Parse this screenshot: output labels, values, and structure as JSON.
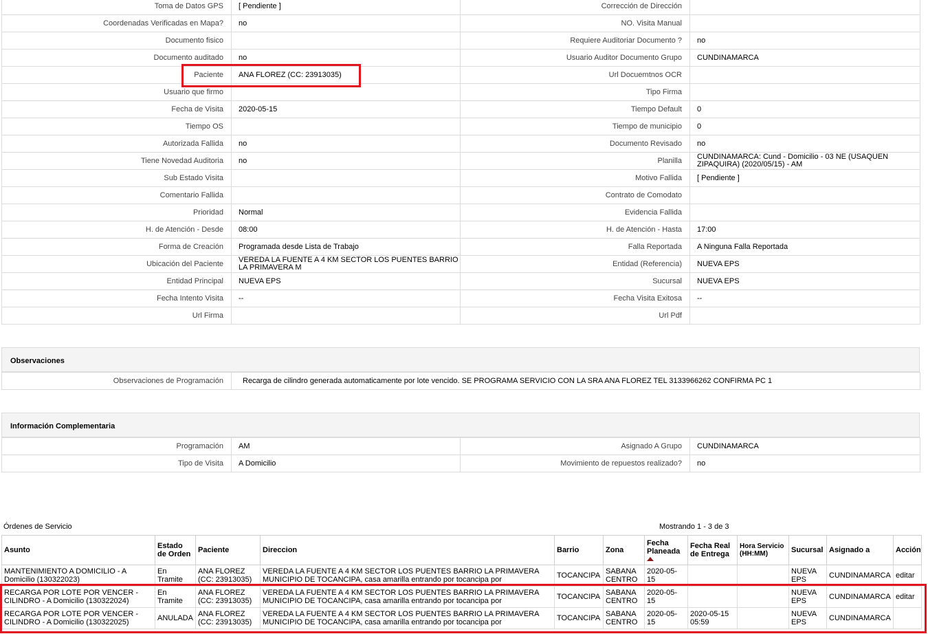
{
  "detail_rows": [
    {
      "l1": "Toma de Datos GPS",
      "v1": "[ Pendiente ]",
      "l2": "Corrección de Dirección",
      "v2": ""
    },
    {
      "l1": "Coordenadas Verificadas en Mapa?",
      "v1": "no",
      "l2": "NO. Visita Manual",
      "v2": ""
    },
    {
      "l1": "Documento fisico",
      "v1": "",
      "l2": "Requiere Auditoriar Documento ?",
      "v2": "no"
    },
    {
      "l1": "Documento auditado",
      "v1": "no",
      "l2": "Usuario Auditor Documento Grupo",
      "v2": "CUNDINAMARCA"
    },
    {
      "l1": "Paciente",
      "v1": "ANA FLOREZ (CC: 23913035)",
      "l2": "Url Docuemtnos OCR",
      "v2": ""
    },
    {
      "l1": "Usuario que firmo",
      "v1": "",
      "l2": "Tipo Firma",
      "v2": ""
    },
    {
      "l1": "Fecha de Visita",
      "v1": "2020-05-15",
      "l2": "Tiempo Default",
      "v2": "0"
    },
    {
      "l1": "Tiempo OS",
      "v1": "",
      "l2": "Tiempo de municipio",
      "v2": "0"
    },
    {
      "l1": "Autorizada Fallida",
      "v1": "no",
      "l2": "Documento Revisado",
      "v2": "no"
    },
    {
      "l1": "Tiene Novedad Auditoria",
      "v1": "no",
      "l2": "Planilla",
      "v2": "CUNDINAMARCA: Cund - Domicilio - 03 NE (USAQUEN ZIPAQUIRA) (2020/05/15) - AM"
    },
    {
      "l1": "Sub Estado Visita",
      "v1": "",
      "l2": "Motivo Fallida",
      "v2": "[ Pendiente ]"
    },
    {
      "l1": "Comentario Fallida",
      "v1": "",
      "l2": "Contrato de Comodato",
      "v2": ""
    },
    {
      "l1": "Prioridad",
      "v1": "Normal",
      "l2": "Evidencia Fallida",
      "v2": ""
    },
    {
      "l1": "H. de Atención - Desde",
      "v1": "08:00",
      "l2": "H. de Atención - Hasta",
      "v2": "17:00"
    },
    {
      "l1": "Forma de Creación",
      "v1": "Programada desde Lista de Trabajo",
      "l2": "Falla Reportada",
      "v2": "A Ninguna Falla Reportada"
    },
    {
      "l1": "Ubicación del Paciente",
      "v1": "VEREDA LA FUENTE A 4 KM SECTOR LOS PUENTES BARRIO LA PRIMAVERA M",
      "l2": "Entidad (Referencia)",
      "v2": "NUEVA EPS"
    },
    {
      "l1": "Entidad Principal",
      "v1": "NUEVA EPS",
      "l2": "Sucursal",
      "v2": "NUEVA EPS"
    },
    {
      "l1": "Fecha Intento Visita",
      "v1": "--",
      "l2": "Fecha Visita Exitosa",
      "v2": "--"
    },
    {
      "l1": "Url Firma",
      "v1": "",
      "l2": "Url Pdf",
      "v2": ""
    }
  ],
  "observaciones": {
    "title": "Observaciones",
    "label": "Observaciones de Programación",
    "value": "Recarga de cilindro generada automaticamente por lote vencido. SE PROGRAMA SERVICIO CON LA SRA ANA FLOREZ TEL 3133966262 CONFIRMA PC 1"
  },
  "complementaria": {
    "title": "Información Complementaria",
    "rows": [
      {
        "l1": "Programación",
        "v1": "AM",
        "l2": "Asignado A Grupo",
        "v2": "CUNDINAMARCA"
      },
      {
        "l1": "Tipo de Visita",
        "v1": "A Domicilio",
        "l2": "Movimiento de repuestos realizado?",
        "v2": "no"
      }
    ]
  },
  "orders": {
    "title": "Órdenes de Servicio",
    "count": "Mostrando 1 - 3 de 3",
    "headers": {
      "asunto": "Asunto",
      "estado": "Estado de Orden",
      "paciente": "Paciente",
      "direccion": "Direccion",
      "barrio": "Barrio",
      "zona": "Zona",
      "fecha_planeada": "Fecha Planeada",
      "fecha_real": "Fecha Real de Entrega",
      "hora": "Hora Servicio (HH:MM)",
      "sucursal": "Sucursal",
      "asignado": "Asignado a",
      "accion": "Acción"
    },
    "rows": [
      {
        "asunto": "MANTENIMIENTO A DOMICILIO - A Domicilio (130322023)",
        "estado": "En Tramite",
        "paciente": "ANA FLOREZ (CC: 23913035)",
        "direccion": "VEREDA LA FUENTE A 4 KM SECTOR LOS PUENTES BARRIO LA PRIMAVERA MUNICIPIO DE TOCANCIPA, casa amarilla entrando por tocancipa por",
        "barrio": "TOCANCIPA",
        "zona": "SABANA CENTRO",
        "fecha_planeada": "2020-05-15",
        "fecha_real": "",
        "hora": "",
        "sucursal": "NUEVA EPS",
        "asignado": "CUNDINAMARCA",
        "accion": "editar"
      },
      {
        "asunto": "RECARGA POR LOTE POR VENCER - CILINDRO - A Domicilio (130322024)",
        "estado": "En Tramite",
        "paciente": "ANA FLOREZ (CC: 23913035)",
        "direccion": "VEREDA LA FUENTE A 4 KM SECTOR LOS PUENTES BARRIO LA PRIMAVERA MUNICIPIO DE TOCANCIPA, casa amarilla entrando por tocancipa por",
        "barrio": "TOCANCIPA",
        "zona": "SABANA CENTRO",
        "fecha_planeada": "2020-05-15",
        "fecha_real": "",
        "hora": "",
        "sucursal": "NUEVA EPS",
        "asignado": "CUNDINAMARCA",
        "accion": "editar"
      },
      {
        "asunto": "RECARGA POR LOTE POR VENCER - CILINDRO - A Domicilio (130322025)",
        "estado": "ANULADA",
        "paciente": "ANA FLOREZ (CC: 23913035)",
        "direccion": "VEREDA LA FUENTE A 4 KM SECTOR LOS PUENTES BARRIO LA PRIMAVERA MUNICIPIO DE TOCANCIPA, casa amarilla entrando por tocancipa por",
        "barrio": "TOCANCIPA",
        "zona": "SABANA CENTRO",
        "fecha_planeada": "2020-05-15",
        "fecha_real": "2020-05-15 05:59",
        "hora": "",
        "sucursal": "NUEVA EPS",
        "asignado": "CUNDINAMARCA",
        "accion": ""
      }
    ]
  },
  "colors": {
    "highlight": "#e0151f",
    "header_bg": "#f4f4f4",
    "border": "#dcdcdc"
  }
}
